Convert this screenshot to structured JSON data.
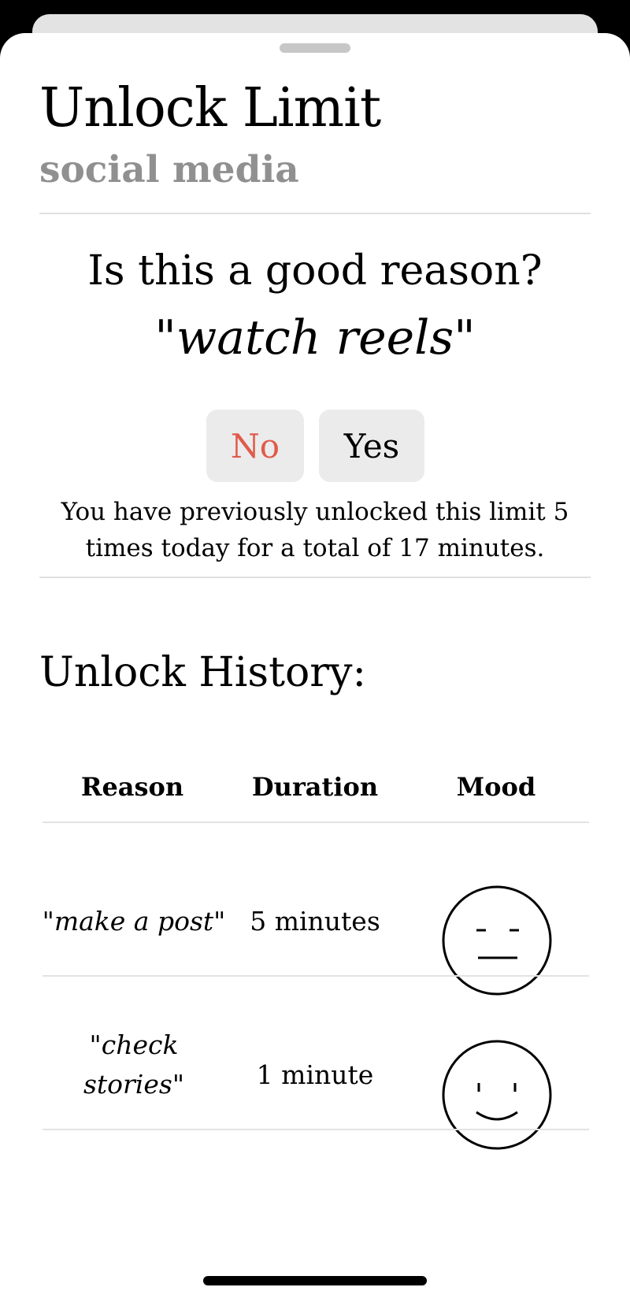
{
  "header": {
    "title": "Unlock Limit",
    "subtitle": "social media"
  },
  "prompt": {
    "question": "Is this a good reason?",
    "reason": "\"watch reels\"",
    "no_label": "No",
    "yes_label": "Yes",
    "info": "You have previously unlocked this limit 5 times today for a total of 17 minutes.",
    "no_color": "#e05a4a"
  },
  "history": {
    "title": "Unlock History:",
    "columns": [
      "Reason",
      "Duration",
      "Mood"
    ],
    "rows": [
      {
        "reason": "\"make a post\"",
        "duration": "5 minutes",
        "mood": "neutral-face-icon"
      },
      {
        "reason": "\"check stories\"",
        "duration": "1 minute",
        "mood": "smile-face-icon"
      }
    ]
  }
}
